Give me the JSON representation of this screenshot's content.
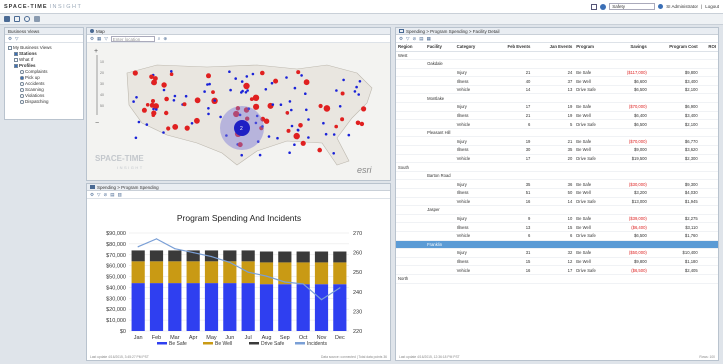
{
  "app": {
    "brand": "SPACE-TIME",
    "brand_sub": "INSIGHT"
  },
  "topright": {
    "safety": "Safety",
    "user": "SI Administrator",
    "logout": "Logout"
  },
  "left_panel": {
    "title": "Business Views",
    "tree": [
      {
        "label": "My Business Views",
        "level": 0,
        "type": "check"
      },
      {
        "label": "Stations",
        "level": 1,
        "type": "check",
        "checked": true
      },
      {
        "label": "What If",
        "level": 1,
        "type": "check"
      },
      {
        "label": "Profiles",
        "level": 1,
        "type": "check",
        "checked": true
      },
      {
        "label": "Complaints",
        "level": 2,
        "type": "radio"
      },
      {
        "label": "Pick up",
        "level": 2,
        "type": "radio",
        "checked": true
      },
      {
        "label": "Accidents",
        "level": 2,
        "type": "radio"
      },
      {
        "label": "Scanning",
        "level": 2,
        "type": "radio"
      },
      {
        "label": "Violations",
        "level": 2,
        "type": "radio"
      },
      {
        "label": "Dispatching",
        "level": 2,
        "type": "radio"
      }
    ]
  },
  "map": {
    "title": "Map",
    "search_placeholder": "Enter location",
    "cluster_label": "2",
    "watermark": "SPACE-TIME",
    "watermark_sub": "INSIGHT",
    "esri": "esri",
    "zoom_ticks": [
      "10",
      "20",
      "30",
      "40",
      "50"
    ]
  },
  "chart_panel": {
    "title": "Spending > Program Spending",
    "footer_left": "Last update 4/16/2015, 3:45:27 PM PST",
    "footer_right": "Data source: connected | Total data points 36"
  },
  "chart_data": {
    "type": "bar",
    "title": "Program Spending And Incidents",
    "categories": [
      "Jan",
      "Feb",
      "Mar",
      "Apr",
      "May",
      "Jun",
      "Jul",
      "Aug",
      "Sep",
      "Oct",
      "Nov",
      "Dec"
    ],
    "ylim": [
      0,
      90000
    ],
    "y_ticks": [
      "$90,000",
      "$80,000",
      "$70,000",
      "$60,000",
      "$50,000",
      "$40,000",
      "$30,000",
      "$20,000",
      "$10,000",
      "$0"
    ],
    "y2lim": [
      220,
      270
    ],
    "y2_ticks": [
      "270",
      "260",
      "250",
      "240",
      "230",
      "220"
    ],
    "series": [
      {
        "name": "Be Safe",
        "values": [
          44000,
          44000,
          44000,
          44000,
          44000,
          44000,
          44000,
          43000,
          43000,
          43000,
          43000,
          43000
        ],
        "color": "#2f3ff0"
      },
      {
        "name": "Be Well",
        "values": [
          20000,
          20000,
          20000,
          20000,
          20000,
          20000,
          20000,
          20000,
          20000,
          20000,
          20000,
          20000
        ],
        "color": "#c99a14"
      },
      {
        "name": "Drive Safe",
        "values": [
          10000,
          10000,
          10000,
          10000,
          10000,
          10000,
          10000,
          10000,
          10000,
          10000,
          10000,
          10000
        ],
        "color": "#3a3a3a"
      }
    ],
    "line": {
      "name": "Incidents",
      "values": [
        263,
        267,
        262,
        260,
        258,
        255,
        250,
        248,
        245,
        244,
        236,
        242
      ],
      "color": "#7a9fd6"
    }
  },
  "detail": {
    "title": "Spending > Program Spending > Facility Detail",
    "columns": [
      "Region",
      "Facility",
      "Category",
      "Feb Events",
      "Jan Events",
      "Program",
      "Savings",
      "Program Cost",
      "ROI"
    ],
    "footer_left": "Last update 4/16/2015, 12:36:18 PM PST",
    "footer_right": "Rows: 100",
    "rows": [
      {
        "kind": "region",
        "region": "West"
      },
      {
        "kind": "facility",
        "facility": "Oakdale"
      },
      {
        "kind": "data",
        "category": "Injury",
        "feb": "21",
        "jan": "24",
        "program": "Be Safe",
        "savings": "($117,000)",
        "cost": "$9,800",
        "neg": true
      },
      {
        "kind": "data",
        "category": "Illness",
        "feb": "40",
        "jan": "37",
        "program": "Be Well",
        "savings": "$6,600",
        "cost": "$3,400"
      },
      {
        "kind": "data",
        "category": "Vehicle",
        "feb": "14",
        "jan": "13",
        "program": "Drive Safe",
        "savings": "$6,500",
        "cost": "$2,100"
      },
      {
        "kind": "facility",
        "facility": "Montlake"
      },
      {
        "kind": "data",
        "category": "Injury",
        "feb": "17",
        "jan": "19",
        "program": "Be Safe",
        "savings": "($70,000)",
        "cost": "$6,900",
        "neg": true
      },
      {
        "kind": "data",
        "category": "Illness",
        "feb": "21",
        "jan": "19",
        "program": "Be Well",
        "savings": "$6,400",
        "cost": "$3,400"
      },
      {
        "kind": "data",
        "category": "Vehicle",
        "feb": "6",
        "jan": "5",
        "program": "Drive Safe",
        "savings": "$6,500",
        "cost": "$2,100"
      },
      {
        "kind": "facility",
        "facility": "Pleasant Hill"
      },
      {
        "kind": "data",
        "category": "Injury",
        "feb": "19",
        "jan": "21",
        "program": "Be Safe",
        "savings": "($70,000)",
        "cost": "$6,770",
        "neg": true
      },
      {
        "kind": "data",
        "category": "Illness",
        "feb": "30",
        "jan": "35",
        "program": "Be Well",
        "savings": "$9,000",
        "cost": "$3,620"
      },
      {
        "kind": "data",
        "category": "Vehicle",
        "feb": "17",
        "jan": "20",
        "program": "Drive Safe",
        "savings": "$19,500",
        "cost": "$2,300"
      },
      {
        "kind": "region",
        "region": "South"
      },
      {
        "kind": "facility",
        "facility": "Barton Road"
      },
      {
        "kind": "data",
        "category": "Injury",
        "feb": "35",
        "jan": "36",
        "program": "Be Safe",
        "savings": "($30,000)",
        "cost": "$9,300",
        "neg": true
      },
      {
        "kind": "data",
        "category": "Illness",
        "feb": "51",
        "jan": "50",
        "program": "Be Well",
        "savings": "$3,200",
        "cost": "$4,030"
      },
      {
        "kind": "data",
        "category": "Vehicle",
        "feb": "16",
        "jan": "14",
        "program": "Drive Safe",
        "savings": "$13,000",
        "cost": "$1,945"
      },
      {
        "kind": "facility",
        "facility": "Jasper"
      },
      {
        "kind": "data",
        "category": "Injury",
        "feb": "9",
        "jan": "10",
        "program": "Be Safe",
        "savings": "($39,000)",
        "cost": "$2,275",
        "neg": true
      },
      {
        "kind": "data",
        "category": "Illness",
        "feb": "13",
        "jan": "15",
        "program": "Be Well",
        "savings": "($6,400)",
        "cost": "$3,110",
        "neg": true
      },
      {
        "kind": "data",
        "category": "Vehicle",
        "feb": "6",
        "jan": "6",
        "program": "Drive Safe",
        "savings": "$6,500",
        "cost": "$1,760"
      },
      {
        "kind": "facility",
        "facility": "Franklin",
        "selected": true
      },
      {
        "kind": "data",
        "category": "Injury",
        "feb": "31",
        "jan": "32",
        "program": "Be Safe",
        "savings": "($50,000)",
        "cost": "$10,400",
        "neg": true
      },
      {
        "kind": "data",
        "category": "Illness",
        "feb": "15",
        "jan": "12",
        "program": "Be Well",
        "savings": "$9,800",
        "cost": "$1,180"
      },
      {
        "kind": "data",
        "category": "Vehicle",
        "feb": "16",
        "jan": "17",
        "program": "Drive Safe",
        "savings": "($6,500)",
        "cost": "$2,405",
        "neg": true
      },
      {
        "kind": "region",
        "region": "North"
      }
    ]
  }
}
